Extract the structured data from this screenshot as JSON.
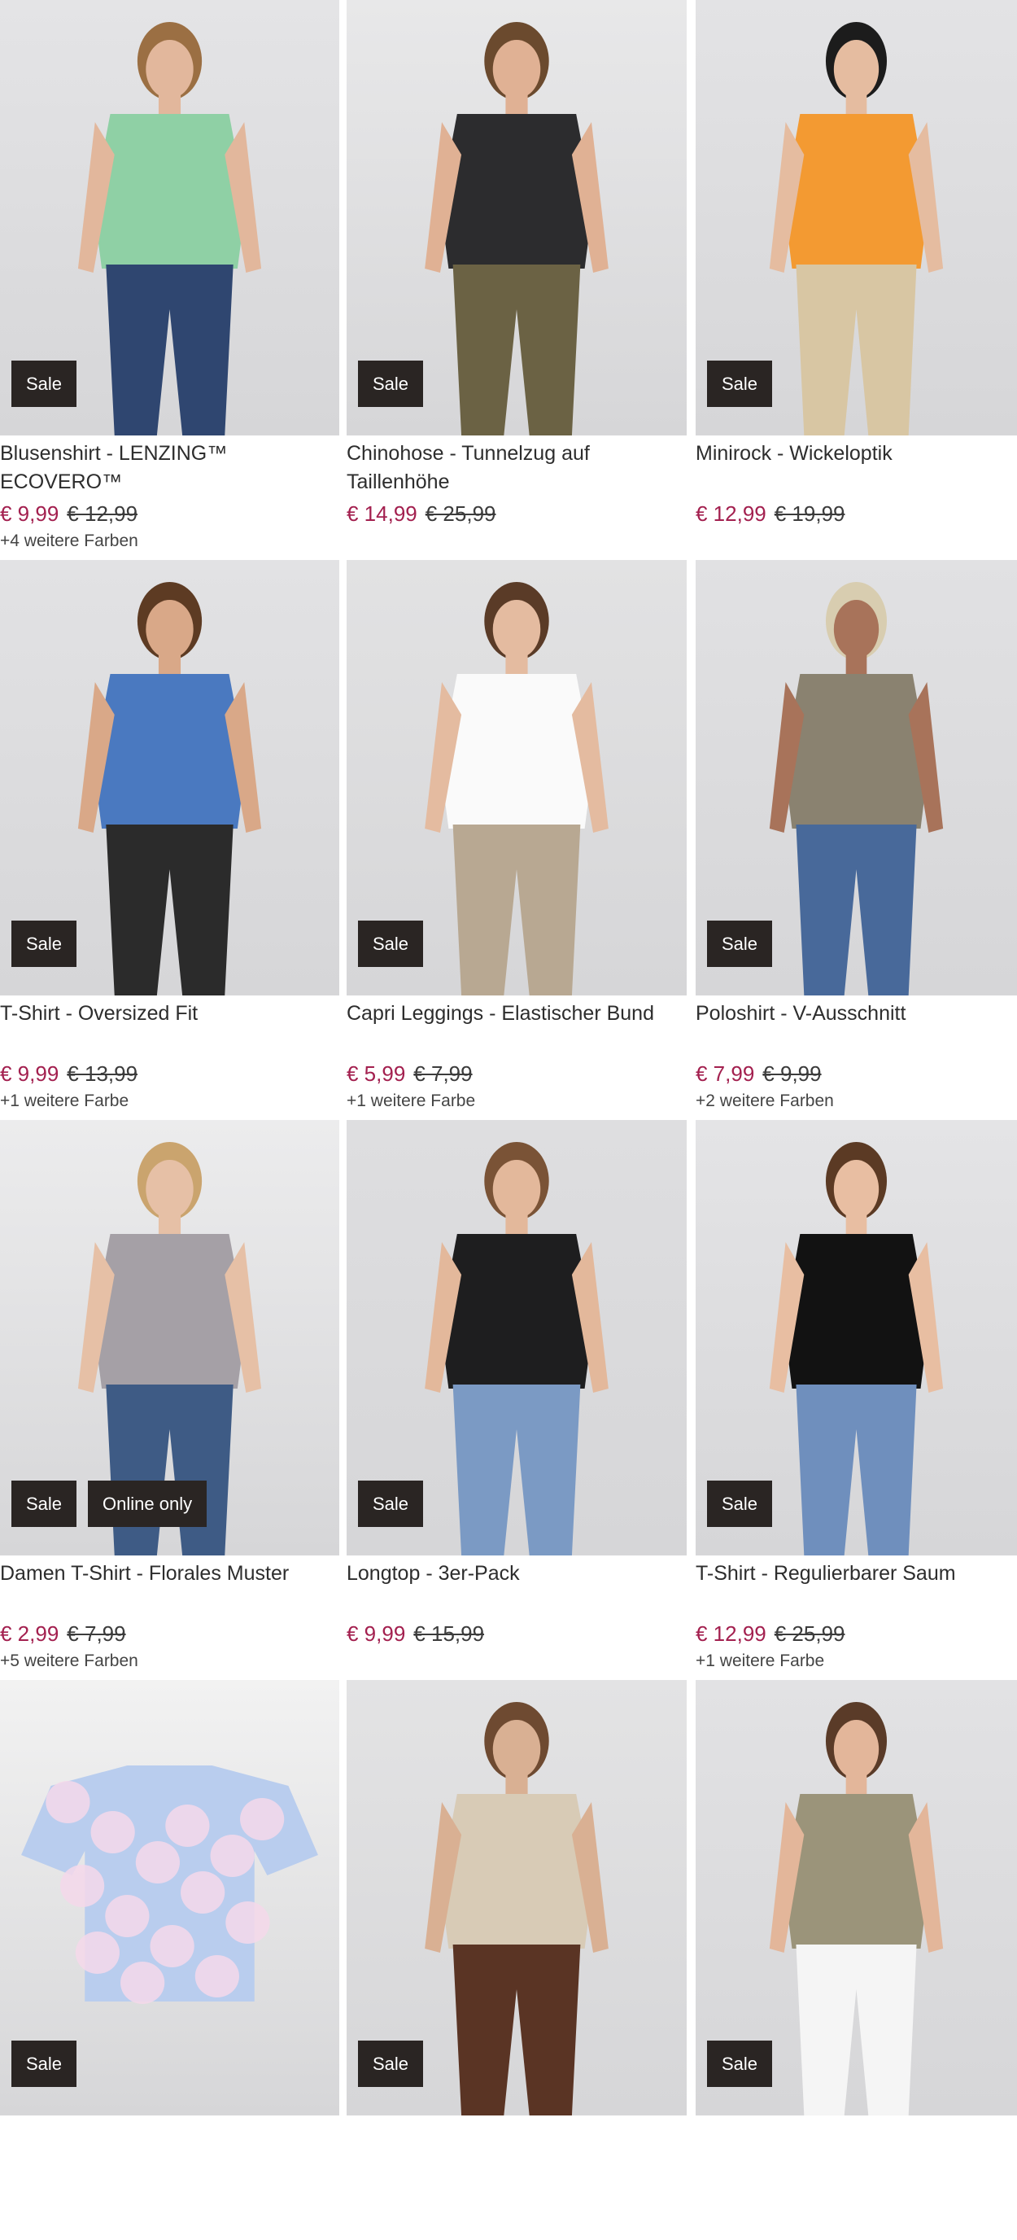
{
  "products": [
    {
      "name": "Blusenshirt - LENZING™ ECOVERO™",
      "price": "€ 9,99",
      "old_price": "€ 12,99",
      "colors": "+4 weitere Farben",
      "badges": [
        "Sale"
      ],
      "palette": {
        "bg": "#e4e4e6",
        "top": "#8fd0a5",
        "bottom": "#2f4670",
        "skin": "#e2b79c",
        "hair": "#9b6f43"
      }
    },
    {
      "name": "Chinohose - Tunnelzug auf Taillenhöhe",
      "price": "€ 14,99",
      "old_price": "€ 25,99",
      "colors": "",
      "badges": [
        "Sale"
      ],
      "palette": {
        "bg": "#e8e8e9",
        "top": "#2c2c2e",
        "bottom": "#6b6244",
        "skin": "#e0b194",
        "hair": "#6b4a2e"
      }
    },
    {
      "name": "Minirock - Wickeloptik",
      "price": "€ 12,99",
      "old_price": "€ 19,99",
      "colors": "",
      "badges": [
        "Sale"
      ],
      "palette": {
        "bg": "#e3e3e5",
        "top": "#f39a32",
        "bottom": "#d8c6a3",
        "skin": "#e5bca0",
        "hair": "#1c1c1c"
      }
    },
    {
      "name": "T-Shirt - Oversized Fit",
      "price": "€ 9,99",
      "old_price": "€ 13,99",
      "colors": "+1 weitere Farbe",
      "badges": [
        "Sale"
      ],
      "palette": {
        "bg": "#e2e2e4",
        "top": "#4a79c0",
        "bottom": "#2b2b2b",
        "skin": "#d9a888",
        "hair": "#5d3b23"
      }
    },
    {
      "name": "Capri Leggings - Elastischer Bund",
      "price": "€ 5,99",
      "old_price": "€ 7,99",
      "colors": "+1 weitere Farbe",
      "badges": [
        "Sale"
      ],
      "palette": {
        "bg": "#e2e2e3",
        "top": "#fafafa",
        "bottom": "#b8a892",
        "skin": "#e4bba0",
        "hair": "#5a3b27"
      }
    },
    {
      "name": "Poloshirt - V-Ausschnitt",
      "price": "€ 7,99",
      "old_price": "€ 9,99",
      "colors": "+2 weitere Farben",
      "badges": [
        "Sale"
      ],
      "palette": {
        "bg": "#e1e1e3",
        "top": "#8a8270",
        "bottom": "#48699a",
        "skin": "#a8735a",
        "hair": "#d8cdb0"
      }
    },
    {
      "name": "Damen T-Shirt - Florales Muster",
      "price": "€ 2,99",
      "old_price": "€ 7,99",
      "colors": "+5 weitere Farben",
      "badges": [
        "Sale",
        "Online only"
      ],
      "palette": {
        "bg": "#ececed",
        "top": "#a5a0a6",
        "bottom": "#3e5b85",
        "skin": "#e6c0a6",
        "hair": "#caa46e"
      }
    },
    {
      "name": "Longtop - 3er-Pack",
      "price": "€ 9,99",
      "old_price": "€ 15,99",
      "colors": "",
      "badges": [
        "Sale"
      ],
      "palette": {
        "bg": "#dedee0",
        "top": "#1e1e1f",
        "bottom": "#7b9ac4",
        "skin": "#e3b89b",
        "hair": "#7a5336"
      }
    },
    {
      "name": "T-Shirt - Regulierbarer Saum",
      "price": "€ 12,99",
      "old_price": "€ 25,99",
      "colors": "+1 weitere Farbe",
      "badges": [
        "Sale"
      ],
      "palette": {
        "bg": "#e4e4e6",
        "top": "#121212",
        "bottom": "#6f8fbd",
        "skin": "#e8bea2",
        "hair": "#5b3a24"
      }
    },
    {
      "name": "",
      "price": "",
      "old_price": "",
      "colors": "",
      "badges": [
        "Sale"
      ],
      "palette": {
        "bg": "#f2f2f2",
        "top": "#b9cdee",
        "bottom": "#f2f2f2",
        "skin": "#f2f2f2",
        "hair": "#f2f2f2"
      }
    },
    {
      "name": "",
      "price": "",
      "old_price": "",
      "colors": "",
      "badges": [
        "Sale"
      ],
      "palette": {
        "bg": "#e3e3e4",
        "top": "#d8cbb6",
        "bottom": "#5a3424",
        "skin": "#d9b093",
        "hair": "#6e4a31"
      }
    },
    {
      "name": "",
      "price": "",
      "old_price": "",
      "colors": "",
      "badges": [
        "Sale"
      ],
      "palette": {
        "bg": "#e2e2e4",
        "top": "#9b947a",
        "bottom": "#f5f5f5",
        "skin": "#e3b69a",
        "hair": "#5a3b28"
      }
    }
  ]
}
